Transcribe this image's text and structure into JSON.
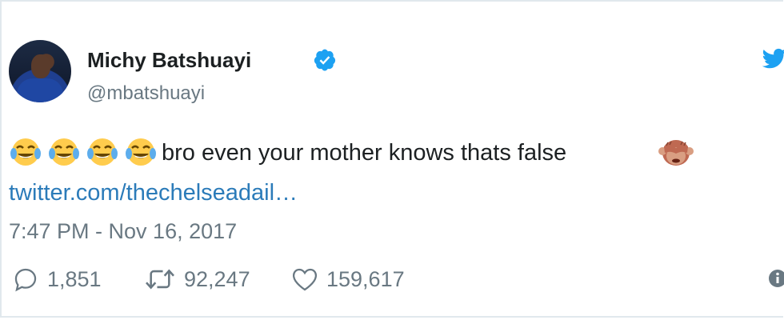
{
  "tweet": {
    "author": {
      "name": "Michy Batshuayi",
      "handle": "@mbatshuayi",
      "verified": true
    },
    "text": "bro even your mother knows thats false",
    "emoji_prefix": [
      "face-with-tears-of-joy",
      "face-with-tears-of-joy",
      "face-with-tears-of-joy",
      "face-with-tears-of-joy"
    ],
    "emoji_suffix": "see-no-evil-monkey",
    "link": "twitter.com/thechelseadail…",
    "timestamp": "7:47 PM - Nov 16, 2017",
    "actions": {
      "replies": "1,851",
      "retweets": "92,247",
      "likes": "159,617"
    }
  },
  "colors": {
    "twitter_blue": "#1da1f2",
    "link_blue": "#2b7bb9",
    "text_primary": "#1c2022",
    "text_secondary": "#697882",
    "border": "#e1e8ed"
  }
}
